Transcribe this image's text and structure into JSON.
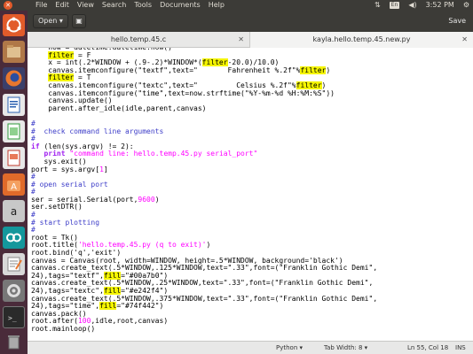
{
  "menubar": {
    "items": [
      "File",
      "Edit",
      "View",
      "Search",
      "Tools",
      "Documents",
      "Help"
    ],
    "keyboard": "En",
    "time": "3:52 PM"
  },
  "header": {
    "open_label": "Open ▾",
    "save_label": "Save"
  },
  "tabs": [
    {
      "label": "hello.temp.45.c"
    },
    {
      "label": "kayla.hello.temp.45.new.py"
    }
  ],
  "code_lines": [
    [
      [
        "t",
        "    now = datetime.datetime.now()"
      ]
    ],
    [
      [
        "t",
        "    "
      ],
      [
        "hl",
        "filter"
      ],
      [
        "t",
        " = F"
      ]
    ],
    [
      [
        "t",
        "    x = int(.2*WINDOW + (.9-.2)*WINDOW*("
      ],
      [
        "hl",
        "filter"
      ],
      [
        "t",
        "-20.0)/10.0)"
      ]
    ],
    [
      [
        "t",
        "    canvas.itemconfigure(\"textf\",text=\"       Fahrenheit %.2f\"%"
      ],
      [
        "hl",
        "filter"
      ],
      [
        "t",
        ")"
      ]
    ],
    [
      [
        "t",
        "    "
      ],
      [
        "hl",
        "filter"
      ],
      [
        "t",
        " = T"
      ]
    ],
    [
      [
        "t",
        "    canvas.itemconfigure(\"textc\",text=\"         Celsius %.2f\"%"
      ],
      [
        "hl",
        "filter"
      ],
      [
        "t",
        ")"
      ]
    ],
    [
      [
        "t",
        "    canvas.itemconfigure(\"time\",text=now.strftime(\"%Y-%m-%d %H:%M:%S\"))"
      ]
    ],
    [
      [
        "t",
        "    canvas.update()"
      ]
    ],
    [
      [
        "t",
        "    parent.after_idle(idle,parent,canvas)"
      ]
    ],
    [
      [
        "t",
        ""
      ]
    ],
    [
      [
        "cm",
        "#"
      ]
    ],
    [
      [
        "cm",
        "#  check command line arguments"
      ]
    ],
    [
      [
        "cm",
        "#"
      ]
    ],
    [
      [
        "kw",
        "if"
      ],
      [
        "t",
        " (len(sys.argv) != 2):"
      ]
    ],
    [
      [
        "t",
        "   "
      ],
      [
        "kw",
        "print"
      ],
      [
        "st",
        " \"command line: hello.temp.45.py serial_port\""
      ]
    ],
    [
      [
        "t",
        "   sys.exit()"
      ]
    ],
    [
      [
        "t",
        "port = sys.argv["
      ],
      [
        "nm",
        "1"
      ],
      [
        "t",
        "]"
      ]
    ],
    [
      [
        "cm",
        "#"
      ]
    ],
    [
      [
        "cm",
        "# open serial port"
      ]
    ],
    [
      [
        "cm",
        "#"
      ]
    ],
    [
      [
        "t",
        "ser = serial.Serial(port,"
      ],
      [
        "nm",
        "9600"
      ],
      [
        "t",
        ")"
      ]
    ],
    [
      [
        "t",
        "ser.setDTR()"
      ]
    ],
    [
      [
        "cm",
        "#"
      ]
    ],
    [
      [
        "cm",
        "# start plotting"
      ]
    ],
    [
      [
        "cm",
        "#"
      ]
    ],
    [
      [
        "t",
        "root = Tk()"
      ]
    ],
    [
      [
        "t",
        "root.title("
      ],
      [
        "st",
        "'hello.temp.45.py (q to exit)'"
      ],
      [
        "t",
        ")"
      ]
    ],
    [
      [
        "t",
        "root.bind('q','exit')"
      ]
    ],
    [
      [
        "t",
        "canvas = Canvas(root, width=WINDOW, height=.5*WINDOW, background='black')"
      ]
    ],
    [
      [
        "t",
        "canvas.create_text(.5*WINDOW,.125*WINDOW,text=\".33\",font=(\"Franklin Gothic Demi\","
      ]
    ],
    [
      [
        "t",
        "24),tags=\"textf\","
      ],
      [
        "hl",
        "fill"
      ],
      [
        "t",
        "=\"#00a7b0\")"
      ]
    ],
    [
      [
        "t",
        "canvas.create_text(.5*WINDOW,.25*WINDOW,text=\".33\",font=(\"Franklin Gothic Demi\","
      ]
    ],
    [
      [
        "t",
        "24),tags=\"textc\","
      ],
      [
        "hl",
        "fill"
      ],
      [
        "t",
        "=\"#e242f4\")"
      ]
    ],
    [
      [
        "t",
        "canvas.create_text(.5*WINDOW,.375*WINDOW,text=\".33\",font=(\"Franklin Gothic Demi\","
      ]
    ],
    [
      [
        "t",
        "24),tags=\"time\","
      ],
      [
        "hl",
        "fill"
      ],
      [
        "t",
        "=\"#74f442\")"
      ]
    ],
    [
      [
        "t",
        "canvas.pack()"
      ]
    ],
    [
      [
        "t",
        "root.after("
      ],
      [
        "nm",
        "100"
      ],
      [
        "t",
        ",idle,root,canvas)"
      ]
    ],
    [
      [
        "t",
        "root.mainloop()"
      ]
    ]
  ],
  "statusbar": {
    "language": "Python ▾",
    "tab_width": "Tab Width: 8 ▾",
    "position": "Ln 55, Col 18",
    "mode": "INS"
  },
  "colors": {
    "launcher_bg": "#4a2b3a",
    "highlight": "#f5f500"
  },
  "launcher_icons": [
    "ubuntu-dash-icon",
    "files-icon",
    "firefox-icon",
    "libreoffice-writer-icon",
    "libreoffice-calc-icon",
    "libreoffice-impress-icon",
    "software-center-icon",
    "amazon-icon",
    "arduino-icon",
    "text-editor-icon",
    "settings-icon",
    "terminal-icon",
    "trash-icon"
  ]
}
